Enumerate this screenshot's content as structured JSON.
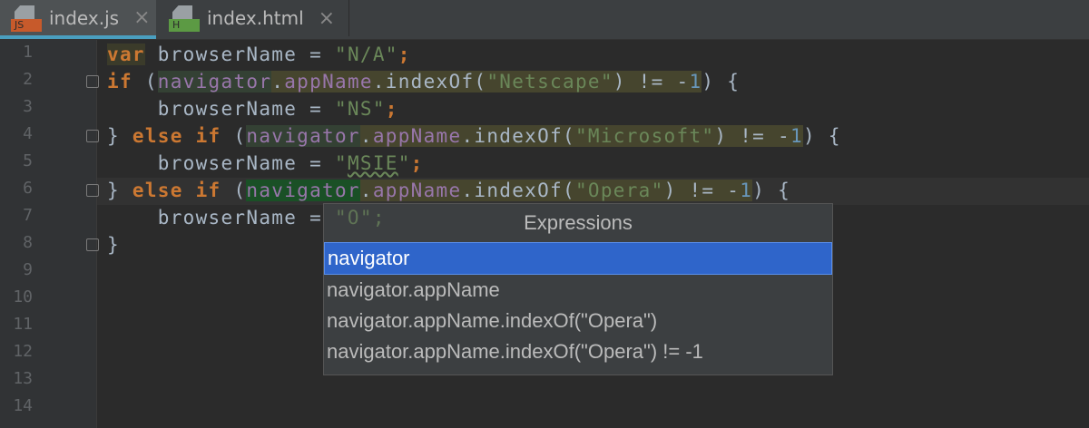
{
  "tabs": [
    {
      "label": "index.js",
      "badge": "JS",
      "badge_color": "#c75a2b",
      "active": true
    },
    {
      "label": "index.html",
      "badge": "H",
      "badge_color": "#5c9a44",
      "active": false
    }
  ],
  "line_numbers": [
    "1",
    "2",
    "3",
    "4",
    "5",
    "6",
    "7",
    "8",
    "9",
    "10",
    "11",
    "12",
    "13",
    "14"
  ],
  "code": {
    "l1": [
      "var",
      " browserName = ",
      "\"N/A\"",
      ";"
    ],
    "l2": [
      "if",
      " (",
      "navigator",
      ".",
      "appName",
      ".indexOf(",
      "\"Netscape\"",
      ") != -",
      "1",
      ") {"
    ],
    "l3": [
      "    browserName = ",
      "\"NS\"",
      ";"
    ],
    "l4": [
      "} ",
      "else if",
      " (",
      "navigator",
      ".",
      "appName",
      ".indexOf(",
      "\"Microsoft\"",
      ") != -",
      "1",
      ") {"
    ],
    "l5": [
      "    browserName = ",
      "\"",
      "MSIE",
      "\"",
      ";"
    ],
    "l6": [
      "} ",
      "else if",
      " (",
      "navigator",
      ".",
      "appName",
      ".indexOf(",
      "\"Opera\"",
      ") != -",
      "1",
      ") {"
    ],
    "l7": [
      "    browserName = ",
      "\"O\";"
    ],
    "l8": [
      "}"
    ]
  },
  "popup": {
    "title": "Expressions",
    "items": [
      "navigator",
      "navigator.appName",
      "navigator.appName.indexOf(\"Opera\")",
      "navigator.appName.indexOf(\"Opera\") != -1"
    ],
    "selected_index": 0
  }
}
